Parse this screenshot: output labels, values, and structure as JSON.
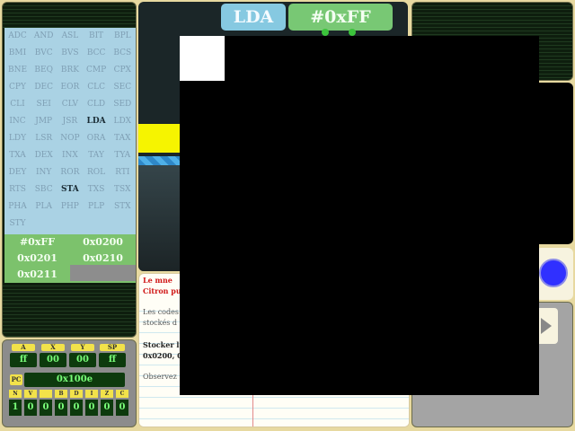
{
  "opcodes": [
    "ADC",
    "AND",
    "ASL",
    "BIT",
    "BPL",
    "BMI",
    "BVC",
    "BVS",
    "BCC",
    "BCS",
    "BNE",
    "BEQ",
    "BRK",
    "CMP",
    "CPX",
    "CPY",
    "DEC",
    "EOR",
    "CLC",
    "SEC",
    "CLI",
    "SEI",
    "CLV",
    "CLD",
    "SED",
    "INC",
    "JMP",
    "JSR",
    "LDA",
    "LDX",
    "LDY",
    "LSR",
    "NOP",
    "ORA",
    "TAX",
    "TXA",
    "DEX",
    "INX",
    "TAY",
    "TYA",
    "DEY",
    "INY",
    "ROR",
    "ROL",
    "RTI",
    "RTS",
    "SBC",
    "STA",
    "TXS",
    "TSX",
    "PHA",
    "PLA",
    "PHP",
    "PLP",
    "STX",
    "STY"
  ],
  "highlighted_opcodes": [
    "LDA",
    "STA"
  ],
  "addresses": [
    "#0xFF",
    "0x0200",
    "0x0201",
    "0x0210",
    "0x0211"
  ],
  "registers": {
    "headers": [
      "A",
      "X",
      "Y",
      "SP"
    ],
    "values": [
      "ff",
      "00",
      "00",
      "ff"
    ],
    "pc_label": "PC",
    "pc_value": "0x100e",
    "flag_headers": [
      "N",
      "V",
      "",
      "B",
      "D",
      "I",
      "Z",
      "C"
    ],
    "flag_values": [
      "1",
      "0",
      "0",
      "0",
      "0",
      "0",
      "0",
      "0"
    ]
  },
  "instruction": {
    "opcode": "LDA",
    "operand": "#0xFF"
  },
  "text": {
    "red_line_1": "Le mne",
    "red_line_2": "Citron pu",
    "body_line_1": "Les codes",
    "body_line_2": "stockés d",
    "bold_line_1": "Stocker l",
    "bold_line_2": "0x0200, 0",
    "obs_line": "Observez"
  },
  "colors": {
    "opcode_bg": "#aad2e4",
    "address_bg": "#7cc26c",
    "lda_button": "#86c9e1",
    "value_button": "#78c874"
  }
}
